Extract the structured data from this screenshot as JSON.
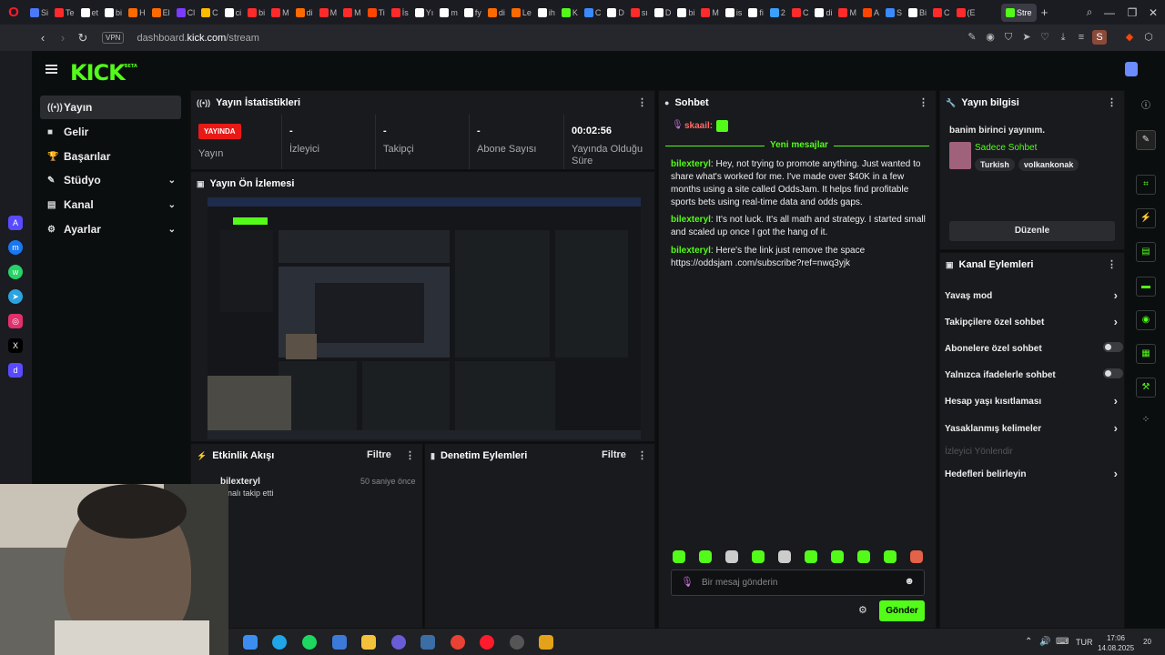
{
  "browser": {
    "tabs": [
      {
        "label": "Si",
        "color": "#4a78ff"
      },
      {
        "label": "Te",
        "color": "#ff2b2b"
      },
      {
        "label": "et",
        "color": "#ffffff"
      },
      {
        "label": "bi",
        "color": "#ffffff"
      },
      {
        "label": "H",
        "color": "#ff6a00"
      },
      {
        "label": "El",
        "color": "#ff6a00"
      },
      {
        "label": "Cl",
        "color": "#7b3cff"
      },
      {
        "label": "C",
        "color": "#ffbb00"
      },
      {
        "label": "ci",
        "color": "#ffffff"
      },
      {
        "label": "bi",
        "color": "#ff2b2b"
      },
      {
        "label": "M",
        "color": "#ff2b2b"
      },
      {
        "label": "di",
        "color": "#ff6a00"
      },
      {
        "label": "M",
        "color": "#ff2b2b"
      },
      {
        "label": "M",
        "color": "#ff2b2b"
      },
      {
        "label": "Ti",
        "color": "#ff4500"
      },
      {
        "label": "İs",
        "color": "#ff2b2b"
      },
      {
        "label": "Yı",
        "color": "#ffffff"
      },
      {
        "label": "m",
        "color": "#ffffff"
      },
      {
        "label": "fy",
        "color": "#ffffff"
      },
      {
        "label": "di",
        "color": "#ff6a00"
      },
      {
        "label": "Le",
        "color": "#ff6a00"
      },
      {
        "label": "ih",
        "color": "#ffffff"
      },
      {
        "label": "K",
        "color": "#53fc18"
      },
      {
        "label": "C",
        "color": "#3a8bff"
      },
      {
        "label": "D",
        "color": "#ffffff"
      },
      {
        "label": "sı",
        "color": "#ff2b2b"
      },
      {
        "label": "D",
        "color": "#ffffff"
      },
      {
        "label": "bi",
        "color": "#ffffff"
      },
      {
        "label": "M",
        "color": "#ff2b2b"
      },
      {
        "label": "is",
        "color": "#ffffff"
      },
      {
        "label": "fi",
        "color": "#ffffff"
      },
      {
        "label": "2",
        "color": "#3aa0ff"
      },
      {
        "label": "C",
        "color": "#ff2b2b"
      },
      {
        "label": "di",
        "color": "#ffffff"
      },
      {
        "label": "M",
        "color": "#ff2b2b"
      },
      {
        "label": "A",
        "color": "#ff4500"
      },
      {
        "label": "S",
        "color": "#3a8bff"
      },
      {
        "label": "Bi",
        "color": "#ffffff"
      },
      {
        "label": "C",
        "color": "#ff2b2b"
      },
      {
        "label": "(E",
        "color": "#ff2b2b"
      }
    ],
    "active_tab": "Stre",
    "url_prefix": "dashboard.",
    "url_domain": "kick.com",
    "url_path": "/stream",
    "vpn": "VPN"
  },
  "kick": {
    "logo": "KICK",
    "logo_beta": "BETA",
    "nav": [
      {
        "label": "Yayın",
        "icon": "((•))"
      },
      {
        "label": "Gelir",
        "icon": "■"
      },
      {
        "label": "Başarılar",
        "icon": "🏆"
      },
      {
        "label": "Stüdyo",
        "icon": "✎"
      },
      {
        "label": "Kanal",
        "icon": "▤"
      },
      {
        "label": "Ayarlar",
        "icon": "⚙"
      }
    ],
    "stats": {
      "title": "Yayın İstatistikleri",
      "badge": "YAYINDA",
      "badge_label": "Yayın",
      "viewers_value": "-",
      "viewers_label": "İzleyici",
      "followers_value": "-",
      "followers_label": "Takipçi",
      "subs_value": "-",
      "subs_label": "Abone Sayısı",
      "uptime_value": "00:02:56",
      "uptime_label_1": "Yayında Olduğu",
      "uptime_label_2": "Süre"
    },
    "preview_title": "Yayın Ön İzlemesi",
    "activity": {
      "title": "Etkinlik Akışı",
      "filter": "Filtre",
      "user": "bilexteryl",
      "time": "50 saniye önce",
      "action": "nalı takip etti"
    },
    "moderation": {
      "title": "Denetim Eylemleri",
      "filter": "Filtre"
    },
    "chat": {
      "title": "Sohbet",
      "pinned_user": "skaail:",
      "new_messages": "Yeni mesajlar",
      "messages": [
        {
          "user": "bilexteryl",
          "text": "Hey, not trying to promote anything. Just wanted to share what's worked for me. I've made over $40K in a few months using a site called OddsJam. It helps find profitable sports bets using real-time data and odds gaps."
        },
        {
          "user": "bilexteryl",
          "text": "It's not luck. It's all math and strategy. I started small and scaled up once I got the hang of it."
        },
        {
          "user": "bilexteryl",
          "text": "Here's the link just remove the space https://oddsjam .com/subscribe?ref=nwq3yjk"
        }
      ],
      "placeholder": "Bir mesaj gönderin",
      "send": "Gönder"
    },
    "stream_info": {
      "title": "Yayın bilgisi",
      "stream_title": "banim birinci yayınım.",
      "category": "Sadece Sohbet",
      "tags": [
        "Turkish",
        "volkankonak"
      ],
      "edit": "Düzenle"
    },
    "channel_actions": {
      "title": "Kanal Eylemleri",
      "items": [
        {
          "label": "Yavaş mod",
          "type": "arrow"
        },
        {
          "label": "Takipçilere özel sohbet",
          "type": "arrow"
        },
        {
          "label": "Abonelere özel sohbet",
          "type": "toggle"
        },
        {
          "label": "Yalnızca ifadelerle sohbet",
          "type": "toggle"
        },
        {
          "label": "Hesap yaşı kısıtlaması",
          "type": "arrow"
        },
        {
          "label": "Yasaklanmış kelimeler",
          "type": "arrow"
        },
        {
          "label": "İzleyici Yönlendir",
          "type": "disabled"
        },
        {
          "label": "Hedefleri belirleyin",
          "type": "arrow"
        }
      ]
    }
  },
  "taskbar": {
    "lang": "TUR",
    "time": "17:06",
    "date": "14.08.2025",
    "notif": "20"
  }
}
